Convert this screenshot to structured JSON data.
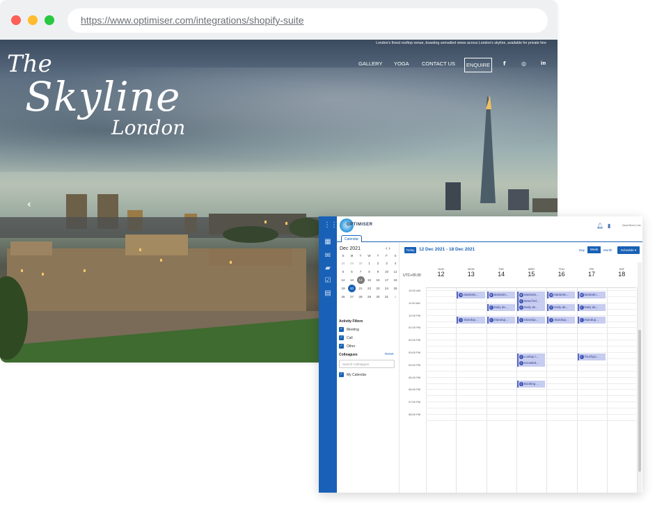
{
  "browser": {
    "url": "https://www.optimiser.com/integrations/shopify-suite",
    "dots": [
      "#fd5f57",
      "#febc2e",
      "#28c840"
    ]
  },
  "hero": {
    "tagline": "London's finest rooftop venue, boasting unrivalled views across London's skyline, available for private hire",
    "logo_line1": "The",
    "logo_line2": "Skyline",
    "logo_line3": "London",
    "nav": [
      "GALLERY",
      "YOGA",
      "CONTACT US"
    ],
    "enquire": "ENQUIRE",
    "social": [
      "f",
      "◎",
      "in"
    ],
    "prev_arrow": "‹"
  },
  "app": {
    "brand": "OPTIMISER",
    "username": "David Brent-Cole",
    "tab": "Calendar",
    "mini_cal": {
      "title": "Dec 2021",
      "nav": "‹  ›",
      "weekdays": [
        "S",
        "M",
        "T",
        "W",
        "T",
        "F",
        "S"
      ],
      "weeks": [
        [
          "28",
          "29",
          "30",
          "1",
          "2",
          "3",
          "4"
        ],
        [
          "5",
          "6",
          "7",
          "8",
          "9",
          "10",
          "11"
        ],
        [
          "12",
          "13",
          "14",
          "15",
          "16",
          "17",
          "18"
        ],
        [
          "19",
          "20",
          "21",
          "22",
          "23",
          "24",
          "25"
        ],
        [
          "26",
          "27",
          "28",
          "29",
          "30",
          "31",
          "1"
        ]
      ],
      "today": "20",
      "selected": "14"
    },
    "filters": {
      "title": "Activity Filters",
      "items": [
        "Meeting",
        "Call",
        "Other"
      ]
    },
    "colleagues": {
      "title": "Colleagues",
      "reset": "Reset",
      "search_placeholder": "Search Colleagues",
      "my_calendar": "My Calendar"
    },
    "toolbar": {
      "today": "Today",
      "range": "12 Dec 2021 - 18 Dec 2021",
      "day": "Day",
      "week": "Week",
      "month": "Month",
      "schedule": "Schedule ▾"
    },
    "timezone": "UTC+05:30",
    "days": [
      {
        "name": "SUN",
        "date": "12"
      },
      {
        "name": "MON",
        "date": "13"
      },
      {
        "name": "TUE",
        "date": "14"
      },
      {
        "name": "WED",
        "date": "15"
      },
      {
        "name": "THU",
        "date": "16"
      },
      {
        "name": "FRI",
        "date": "17"
      },
      {
        "name": "SAT",
        "date": "18"
      }
    ],
    "times": [
      "10:00 AM",
      "11:00 AM",
      "12:00 PM",
      "01:00 PM",
      "02:00 PM",
      "03:00 PM",
      "04:00 PM",
      "05:00 PM",
      "06:00 PM",
      "07:00 PM",
      "08:00 PM"
    ],
    "events": [
      {
        "title": "Marketin...",
        "badge": "M",
        "day": 1,
        "hour": 10.0
      },
      {
        "title": "Marketin...",
        "badge": "M",
        "day": 2,
        "hour": 10.0
      },
      {
        "title": "Marketin...",
        "badge": "M",
        "day": 3,
        "hour": 10.0
      },
      {
        "title": "Marketin...",
        "badge": "M",
        "day": 4,
        "hour": 10.0
      },
      {
        "title": "Marketin...",
        "badge": "M",
        "day": 5,
        "hour": 10.0
      },
      {
        "title": "Need hel...",
        "badge": "C",
        "day": 3,
        "hour": 10.5
      },
      {
        "title": "Daily de...",
        "badge": "C",
        "day": 3,
        "hour": 11.0
      },
      {
        "title": "Daily de...",
        "badge": "C",
        "day": 4,
        "hour": 11.0
      },
      {
        "title": "Daily de...",
        "badge": "C",
        "day": 5,
        "hour": 11.0
      },
      {
        "title": "Daily de...",
        "badge": "C",
        "day": 2,
        "hour": 11.0
      },
      {
        "title": "Standup...",
        "badge": "C",
        "day": 1,
        "hour": 12.0
      },
      {
        "title": "Standup...",
        "badge": "C",
        "day": 2,
        "hour": 12.0
      },
      {
        "title": "Standup...",
        "badge": "C",
        "day": 3,
        "hour": 12.0
      },
      {
        "title": "Standup...",
        "badge": "C",
        "day": 4,
        "hour": 12.0
      },
      {
        "title": "Standup...",
        "badge": "C",
        "day": 5,
        "hour": 12.0
      },
      {
        "title": "Lookup i...",
        "badge": "C",
        "day": 3,
        "hour": 15.0
      },
      {
        "title": "Knowled...",
        "badge": "C",
        "day": 3,
        "hour": 15.5
      },
      {
        "title": "Touchpo...",
        "badge": "C",
        "day": 5,
        "hour": 15.0
      },
      {
        "title": "Booking ...",
        "badge": "C",
        "day": 3,
        "hour": 17.2
      }
    ]
  }
}
